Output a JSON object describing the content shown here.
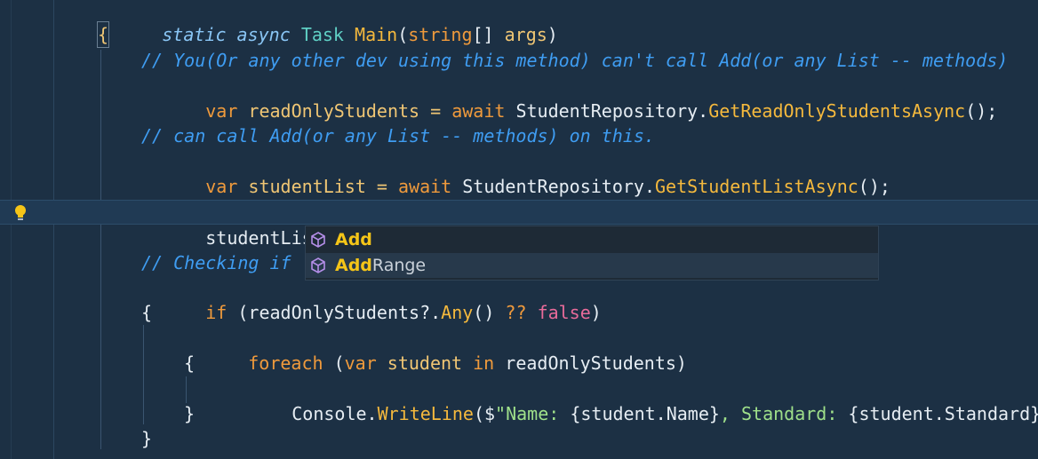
{
  "editor": {
    "lines": {
      "l1": {
        "kw1": "static",
        "kw2": "async",
        "type": "Task",
        "fn": "Main",
        "p1": "(",
        "kw3": "string",
        "p2": "[] ",
        "arg": "args",
        "p3": ")"
      },
      "l2": {
        "brace": "{"
      },
      "l3": {
        "comment": "// You(Or any other dev using this method) can't call Add(or any List -- methods)"
      },
      "l4": {
        "kw": "var",
        "name": " readOnlyStudents = ",
        "await": "await",
        "cls": " StudentRepository.",
        "method": "GetReadOnlyStudentsAsync",
        "tail": "();"
      },
      "l6": {
        "comment": "// can call Add(or any List -- methods) on this."
      },
      "l7": {
        "kw": "var",
        "name": " studentList = ",
        "await": "await",
        "cls": " StudentRepository.",
        "method": "GetStudentListAsync",
        "tail": "();"
      },
      "l9": {
        "obj": "studentList.",
        "typed": "add"
      },
      "l11": {
        "comment": "// Checking if"
      },
      "l12": {
        "kw": "if",
        "p1": " (readOnlyStudents?.",
        "fn": "Any",
        "p2": "() ",
        "op": "??",
        "sp": " ",
        "false": "false",
        "p3": ")"
      },
      "l13": {
        "brace": "{"
      },
      "l14": {
        "kw": "foreach",
        "p1": " (",
        "var": "var",
        "sp": " student ",
        "in": "in",
        "p2": " readOnlyStudents)"
      },
      "l15": {
        "brace": "{"
      },
      "l16": {
        "obj": "Console.",
        "fn": "WriteLine",
        "p1": "(",
        "dollar": "$",
        "s1": "\"Name: ",
        "i1": "{student.Name}",
        "s2": ", Standard: ",
        "i2": "{student.Standard}",
        "s3": "\"",
        "p2": ");"
      },
      "l17": {
        "brace": "}"
      },
      "l18": {
        "brace": "}"
      }
    }
  },
  "intellisense": {
    "items": [
      {
        "match": "Add",
        "rest": ""
      },
      {
        "match": "Add",
        "rest": "Range"
      }
    ]
  },
  "colors": {
    "background": "#1c3044",
    "accent": "#f5c518"
  }
}
